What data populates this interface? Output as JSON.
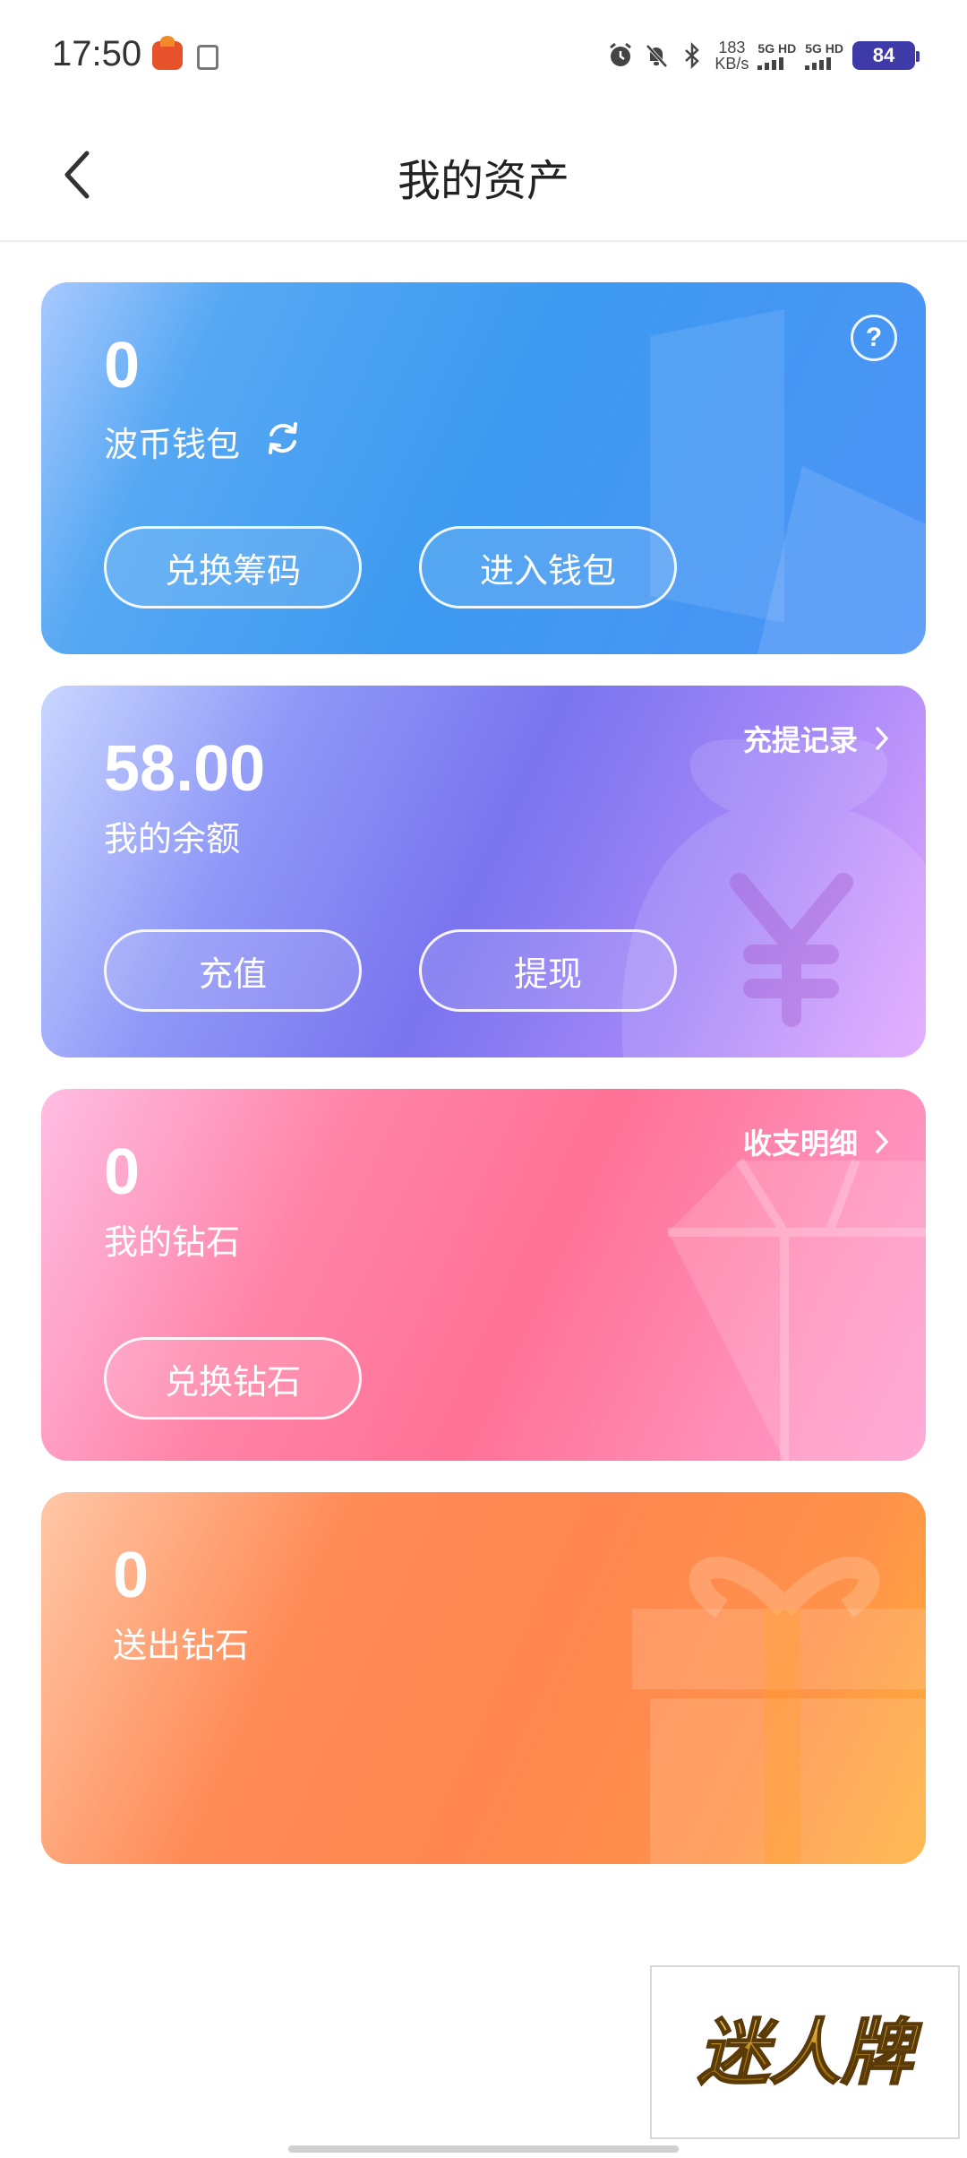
{
  "status_bar": {
    "time": "17:50",
    "speed_value": "183",
    "speed_unit": "KB/s",
    "net1": "5G HD",
    "net2": "5G HD",
    "battery": "84"
  },
  "header": {
    "title": "我的资产"
  },
  "wallet_card": {
    "amount": "0",
    "label": "波币钱包",
    "buttons": [
      "兑换筹码",
      "进入钱包"
    ]
  },
  "balance_card": {
    "amount": "58.00",
    "label": "我的余额",
    "link": "充提记录",
    "buttons": [
      "充值",
      "提现"
    ]
  },
  "diamond_card": {
    "amount": "0",
    "label": "我的钻石",
    "link": "收支明细",
    "buttons": [
      "兑换钻石"
    ]
  },
  "gift_card": {
    "amount": "0",
    "label": "送出钻石"
  },
  "watermark": {
    "text": "迷人牌"
  },
  "colors": {
    "wallet": "#3d9af0",
    "balance": "#7a74ef",
    "diamond": "#ff7196",
    "gift": "#ff8650"
  }
}
